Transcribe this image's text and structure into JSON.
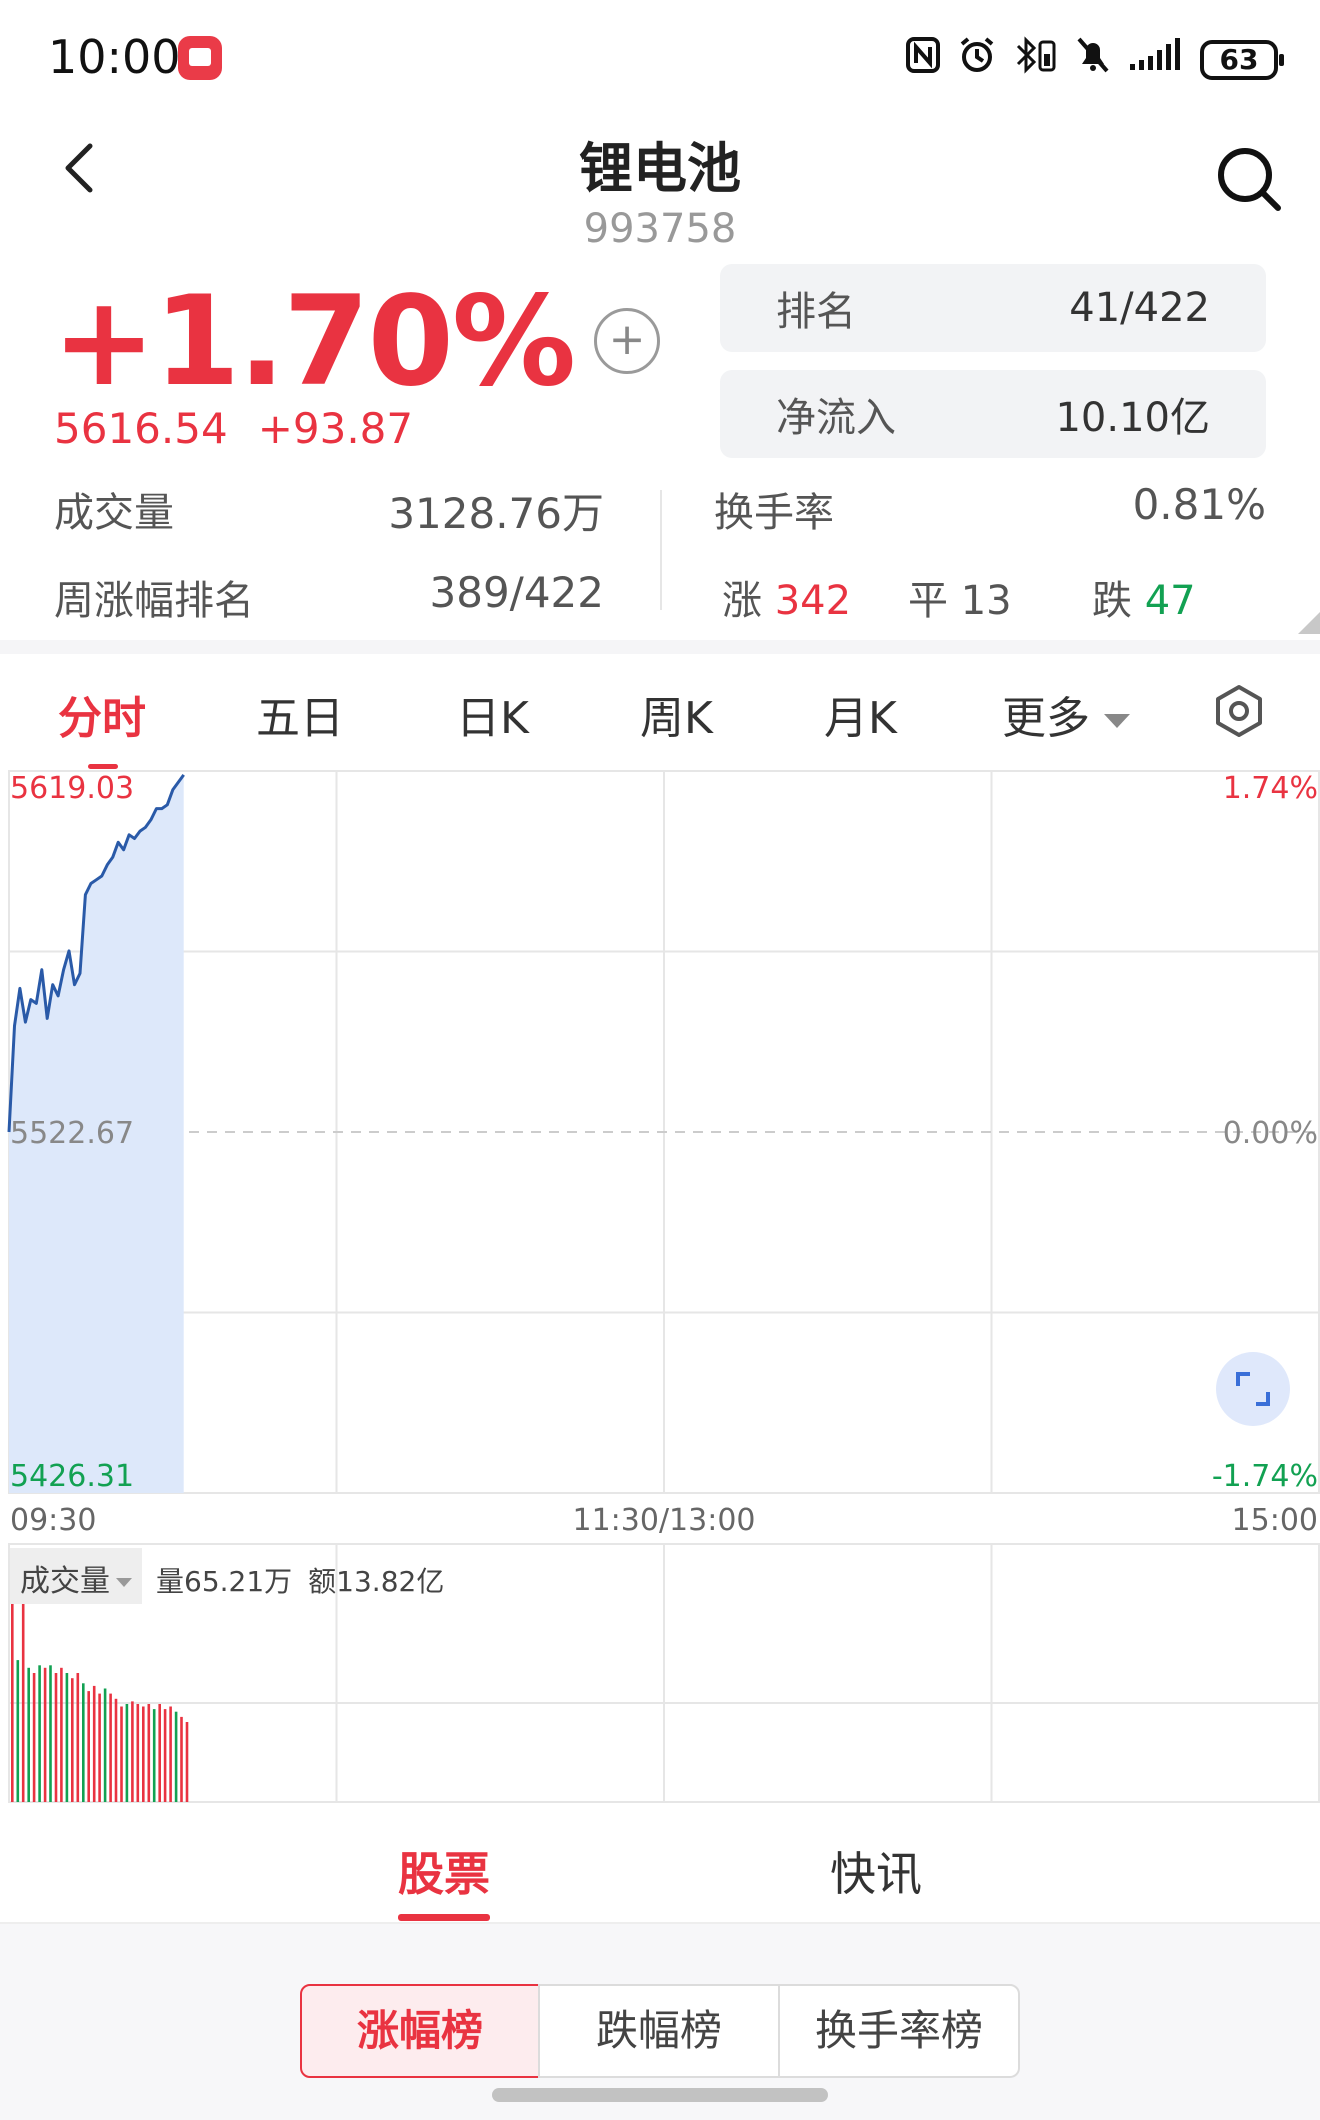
{
  "status_bar": {
    "time": "10:00",
    "battery": "63",
    "icons": [
      "nfc-icon",
      "alarm-icon",
      "bluetooth-icon",
      "mute-icon",
      "signal-icon",
      "battery-icon"
    ]
  },
  "header": {
    "title": "锂电池",
    "code": "993758"
  },
  "quote": {
    "change_pct": "+1.70%",
    "price": "5616.54",
    "change": "+93.87",
    "rank_label": "排名",
    "rank_value": "41/422",
    "inflow_label": "净流入",
    "inflow_value": "10.10亿",
    "volume_label": "成交量",
    "volume_value": "3128.76万",
    "turnover_label": "换手率",
    "turnover_value": "0.81%",
    "week_rank_label": "周涨幅排名",
    "week_rank_value": "389/422",
    "up_label": "涨",
    "up_count": "342",
    "flat_label": "平",
    "flat_count": "13",
    "down_label": "跌",
    "down_count": "47"
  },
  "chart_tabs": [
    "分时",
    "五日",
    "日K",
    "周K",
    "月K",
    "更多"
  ],
  "chart_data": {
    "type": "line",
    "y_labels": {
      "max": "5619.03",
      "mid": "5522.67",
      "min": "5426.31"
    },
    "pct_labels": {
      "max": "1.74%",
      "mid": "0.00%",
      "min": "-1.74%"
    },
    "x_labels": [
      "09:30",
      "11:30/13:00",
      "15:00"
    ],
    "ylim": [
      5426.31,
      5619.03
    ],
    "prev_close": 5522.67,
    "total_minutes": 240,
    "price_series": [
      5522.67,
      5551,
      5561,
      5552,
      5558,
      5557,
      5566,
      5553,
      5562,
      5559,
      5566,
      5571,
      5562,
      5565,
      5586,
      5589,
      5590,
      5591,
      5594,
      5596,
      5600,
      5598,
      5602,
      5601,
      5603,
      5604,
      5606,
      5609,
      5609,
      5610,
      5614,
      5616,
      5618
    ],
    "volume": {
      "info_volume": "量65.21万",
      "info_amount": "额13.82亿",
      "bars": [
        0.98,
        0.55,
        0.78,
        0.52,
        0.5,
        0.53,
        0.52,
        0.53,
        0.5,
        0.52,
        0.5,
        0.48,
        0.5,
        0.46,
        0.43,
        0.45,
        0.42,
        0.44,
        0.42,
        0.4,
        0.37,
        0.38,
        0.39,
        0.38,
        0.37,
        0.38,
        0.36,
        0.38,
        0.36,
        0.37,
        0.35,
        0.33,
        0.31
      ],
      "bar_colors": [
        "#e93341",
        "#12a152",
        "#e93341",
        "#12a152",
        "#e93341",
        "#12a152",
        "#e93341",
        "#12a152",
        "#e93341",
        "#e93341",
        "#12a152",
        "#e93341",
        "#e93341",
        "#12a152",
        "#e93341",
        "#e93341",
        "#e93341",
        "#12a152",
        "#e93341",
        "#e93341",
        "#e93341",
        "#12a152",
        "#e93341",
        "#e93341",
        "#e93341",
        "#e93341",
        "#12a152",
        "#e93341",
        "#e93341",
        "#e93341",
        "#12a152",
        "#e93341",
        "#e93341"
      ]
    }
  },
  "volume_indicator": "成交量",
  "bottom_tabs": [
    "股票",
    "快讯"
  ],
  "rank_segments": [
    "涨幅榜",
    "跌幅榜",
    "换手率榜"
  ],
  "colors": {
    "up": "#e93341",
    "down": "#12a152",
    "line": "#2a5aa8",
    "area": "#dde8fa"
  }
}
